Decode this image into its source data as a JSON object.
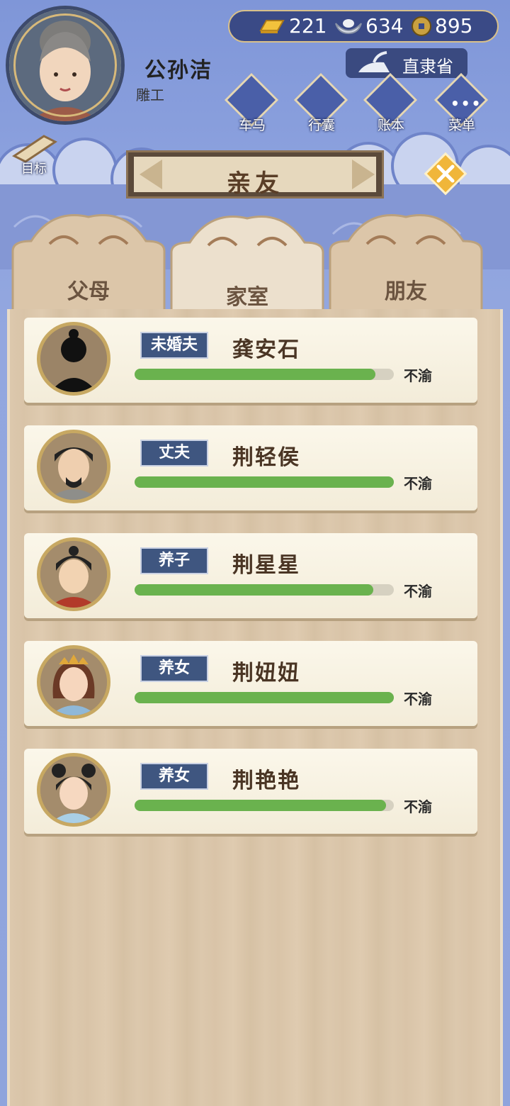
{
  "player": {
    "name": "公孙洁",
    "title": "雕工"
  },
  "currency": {
    "gold": "221",
    "silver": "634",
    "coins": "895"
  },
  "region": "直隶省",
  "menu": {
    "carriage": "车马",
    "luggage": "行囊",
    "ledger": "账本",
    "main_menu": "菜单"
  },
  "goal_label": "目标",
  "panel_title": "亲友",
  "tabs": [
    {
      "label": "父母",
      "active": false
    },
    {
      "label": "家室",
      "active": true
    },
    {
      "label": "朋友",
      "active": false
    }
  ],
  "relatives": [
    {
      "role": "未婚夫",
      "name": "龚安石",
      "affection": 0.93,
      "status": "不渝",
      "avatar": "silhouette-man"
    },
    {
      "role": "丈夫",
      "name": "荆轻侯",
      "affection": 1.0,
      "status": "不渝",
      "avatar": "bearded-man"
    },
    {
      "role": "养子",
      "name": "荆星星",
      "affection": 0.92,
      "status": "不渝",
      "avatar": "boy"
    },
    {
      "role": "养女",
      "name": "荆妞妞",
      "affection": 1.0,
      "status": "不渝",
      "avatar": "girl-crown"
    },
    {
      "role": "养女",
      "name": "荆艳艳",
      "affection": 0.97,
      "status": "不渝",
      "avatar": "girl-buns"
    }
  ],
  "colors": {
    "role_badge": "#3f5680",
    "affection_bar": "#6ab24e",
    "background": "#8ea3df"
  }
}
